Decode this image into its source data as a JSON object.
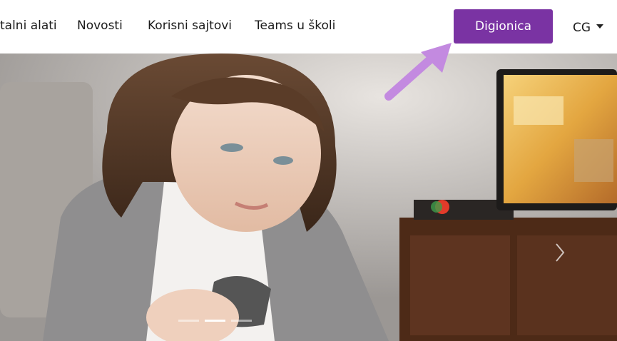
{
  "nav": {
    "items": [
      {
        "label": "talni alati"
      },
      {
        "label": "Novosti"
      },
      {
        "label": "Korisni sajtovi"
      },
      {
        "label": "Teams u školi"
      }
    ],
    "cta_label": "Digionica",
    "language": "CG"
  },
  "carousel": {
    "slide_count": 3,
    "active_index": 1
  },
  "colors": {
    "cta": "#7a33a3",
    "arrow": "#c38ae0"
  }
}
